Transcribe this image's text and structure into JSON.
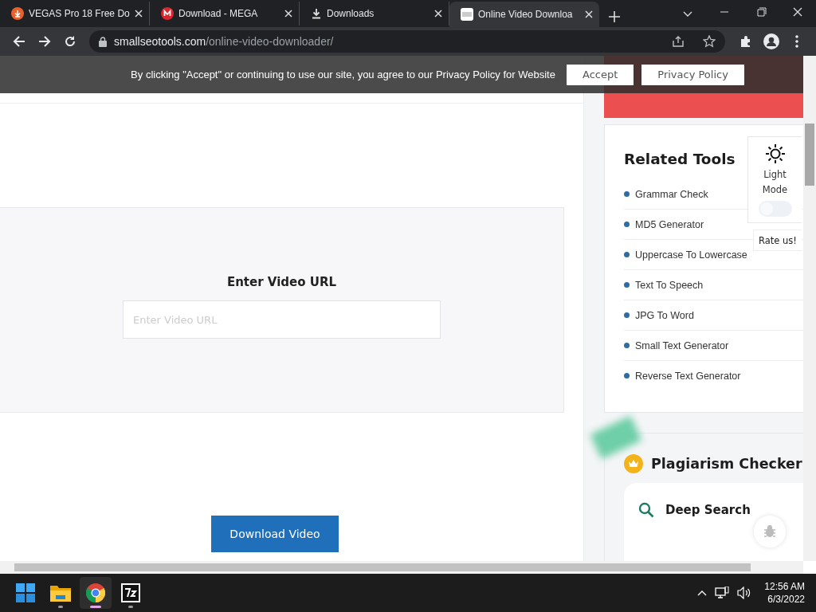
{
  "browser": {
    "tabs": [
      {
        "title": "VEGAS Pro 18 Free Do",
        "kind": "download-site",
        "selected": false
      },
      {
        "title": "Download - MEGA",
        "kind": "mega",
        "selected": false
      },
      {
        "title": "Downloads",
        "kind": "downloads",
        "selected": false
      },
      {
        "title": "Online Video Downloa",
        "kind": "sst",
        "selected": true
      }
    ],
    "url_host": "smallseotools.com",
    "url_path": "/online-video-downloader/"
  },
  "cookie_banner": {
    "text": "By clicking \"Accept\" or continuing to use our site, you agree to our Privacy Policy for Website",
    "buttons": [
      "Accept",
      "Privacy Policy"
    ]
  },
  "downloader": {
    "heading": "Enter Video URL",
    "placeholder": "Enter Video URL",
    "button": "Download Video"
  },
  "related_tools": {
    "title": "Related Tools",
    "items": [
      "Grammar Check",
      "MD5 Generator",
      "Uppercase To Lowercase",
      "Text To Speech",
      "JPG To Word",
      "Small Text Generator",
      "Reverse Text Generator"
    ]
  },
  "theme_widget": {
    "label": "Light Mode",
    "dark_mode": false
  },
  "rate_button": "Rate us!",
  "plagiarism": {
    "title": "Plagiarism Checker",
    "features": [
      "Deep Search"
    ]
  },
  "taskbar": {
    "apps": [
      {
        "kind": "start",
        "selected": false
      },
      {
        "kind": "folder",
        "selected": false
      },
      {
        "kind": "chrome",
        "selected": true
      },
      {
        "kind": "archiver",
        "selected": false
      }
    ],
    "time": "12:56 AM",
    "date": "6/3/2022"
  }
}
